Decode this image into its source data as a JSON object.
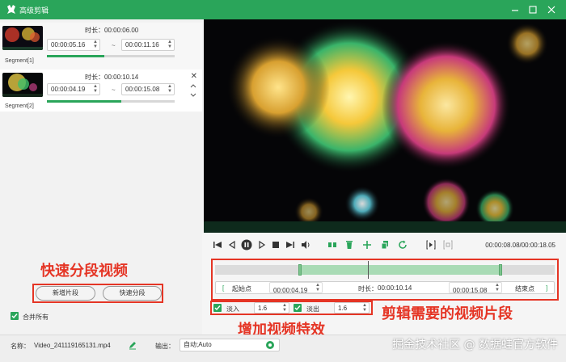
{
  "window": {
    "title": "高级剪辑"
  },
  "segments": [
    {
      "label": "Segment[1]",
      "duration": "时长：00:00:06.00",
      "start": "00:00:05.16",
      "end": "00:00:11.16",
      "tilde": "~",
      "progress": 0.45
    },
    {
      "label": "Segment[2]",
      "duration": "时长：00:00:10.14",
      "start": "00:00:04.19",
      "end": "00:00:15.08",
      "tilde": "~",
      "progress": 0.58
    }
  ],
  "callouts": {
    "quick_segment": "快速分段视频",
    "clip_needed": "剪辑需要的视频片段",
    "add_effects": "增加视频特效"
  },
  "buttons": {
    "add_segment": "新增片段",
    "quick_split": "快速分段"
  },
  "merge_all": "合并所有",
  "player": {
    "time_readout": "00:00:08.08/00:00:18.05"
  },
  "timeline": {
    "range_start": 0.25,
    "range_end": 0.84,
    "playhead": 0.45
  },
  "trim": {
    "left_bracket": "[",
    "start_label": "起始点",
    "start_value": "00:00:04.19",
    "duration_label": "时长：",
    "duration_value": "00:00:10.14",
    "end_value": "00:00:15.08",
    "end_label": "结束点",
    "right_bracket": "]"
  },
  "effects": {
    "fade_in_label": "淡入",
    "fade_in_value": "1.6",
    "fade_out_label": "淡出",
    "fade_out_value": "1.6"
  },
  "footer": {
    "name_label": "名称：",
    "filename": "Video_241119165131.mp4",
    "output_label": "输出：",
    "output_value": "自动;Auto"
  },
  "watermark": "掘金技术社区 @ 数据蛙官方软件",
  "colors": {
    "brand": "#2aa55a",
    "callout": "#e53525"
  }
}
